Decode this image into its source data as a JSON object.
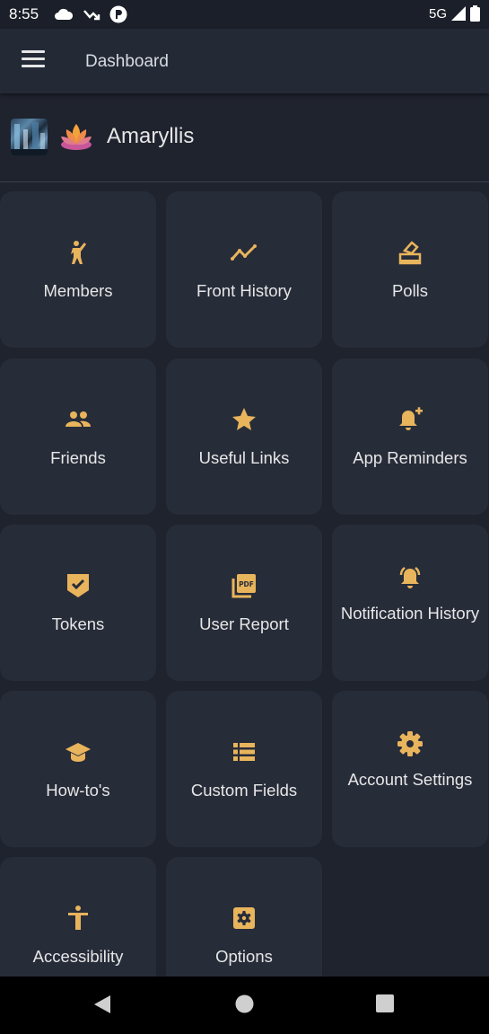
{
  "status_bar": {
    "time": "8:55",
    "network": "5G"
  },
  "app_bar": {
    "title": "Dashboard"
  },
  "system": {
    "name": "Amaryllis"
  },
  "tiles": [
    {
      "label": "Members",
      "icon": "person-waving-icon"
    },
    {
      "label": "Front History",
      "icon": "trend-line-icon"
    },
    {
      "label": "Polls",
      "icon": "ballot-box-icon"
    },
    {
      "label": "Friends",
      "icon": "people-icon"
    },
    {
      "label": "Useful Links",
      "icon": "star-icon"
    },
    {
      "label": "App Reminders",
      "icon": "bell-plus-icon"
    },
    {
      "label": "Tokens",
      "icon": "shield-check-icon"
    },
    {
      "label": "User Report",
      "icon": "pdf-icon"
    },
    {
      "label": "Notification History",
      "icon": "bell-ringing-icon"
    },
    {
      "label": "How-to's",
      "icon": "graduation-cap-icon"
    },
    {
      "label": "Custom Fields",
      "icon": "list-icon"
    },
    {
      "label": "Account Settings",
      "icon": "gear-icon"
    },
    {
      "label": "Accessibility",
      "icon": "accessibility-icon"
    },
    {
      "label": "Options",
      "icon": "settings-box-icon"
    }
  ],
  "colors": {
    "accent": "#e8b45c",
    "background": "#1f232e",
    "tile": "#272c39"
  }
}
